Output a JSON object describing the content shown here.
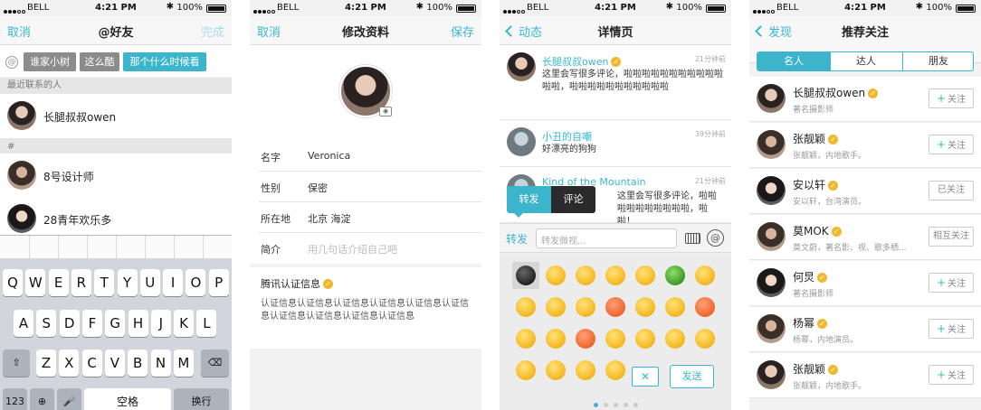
{
  "status": {
    "carrier": "BELL",
    "time": "4:21 PM",
    "battery": "100%"
  },
  "screen1": {
    "nav": {
      "left": "取消",
      "title": "@好友",
      "right": "完成"
    },
    "tags": [
      "谁家小树",
      "这么酷",
      "那个什么时候看"
    ],
    "recent_header": "最近联系的人",
    "recent": [
      {
        "name": "长腿叔叔owen"
      }
    ],
    "hash_header": "#",
    "contacts": [
      {
        "name": "8号设计师"
      },
      {
        "name": "28青年欢乐多"
      }
    ],
    "keyboard": {
      "row1": [
        "Q",
        "W",
        "E",
        "R",
        "T",
        "Y",
        "U",
        "I",
        "O",
        "P"
      ],
      "row2": [
        "A",
        "S",
        "D",
        "F",
        "G",
        "H",
        "J",
        "K",
        "L"
      ],
      "row3": [
        "Z",
        "X",
        "C",
        "V",
        "B",
        "N",
        "M"
      ],
      "num": "123",
      "space": "空格",
      "return": "换行"
    }
  },
  "screen2": {
    "nav": {
      "left": "取消",
      "title": "修改资料",
      "right": "保存"
    },
    "fields": [
      {
        "label": "名字",
        "value": "Veronica"
      },
      {
        "label": "性别",
        "value": "保密"
      },
      {
        "label": "所在地",
        "value": "北京   海淀"
      },
      {
        "label": "简介",
        "value": "用几句话介绍自己吧"
      }
    ],
    "cert_title": "腾讯认证信息",
    "cert_text": "认证信息认证信息认证信息认证信息认证信息认证信息认证信息认证信息认证信息认证信息"
  },
  "screen3": {
    "nav": {
      "left": "动态",
      "title": "详情页"
    },
    "posts": [
      {
        "name": "长腿叔叔owen",
        "time": "21分钟前",
        "body": "这里会写很多评论，啦啦啦啦啦啦啦啦啦啦啦啦啦，啦啦啦啦啦啦啦啦啦啦啦"
      },
      {
        "name": "小丑的自嘲",
        "time": "39分钟前",
        "body": "好漂亮的狗狗"
      },
      {
        "name": "Kind of the Mountain",
        "time": "21分钟前",
        "body": "这里会写很多评论，啦啦啦啦啦啦啦啦啦啦，啦啦！"
      }
    ],
    "popup": {
      "forward": "转发",
      "comment": "评论"
    },
    "input": {
      "mode": "转发",
      "placeholder": "转发微视..."
    },
    "send": "发送"
  },
  "screen4": {
    "nav": {
      "left": "发现",
      "title": "推荐关注"
    },
    "segments": [
      "名人",
      "达人",
      "朋友"
    ],
    "users": [
      {
        "name": "长腿叔叔owen",
        "desc": "著名摄影师",
        "button": "关注",
        "plus": true
      },
      {
        "name": "张靓颖",
        "desc": "张靓颖，内地歌手。",
        "button": "关注",
        "plus": true
      },
      {
        "name": "安以轩",
        "desc": "安以轩，台湾演员。",
        "button": "已关注",
        "plus": false
      },
      {
        "name": "莫MOK",
        "desc": "莫文蔚，著名影、视、歌多栖...",
        "button": "相互关注",
        "plus": false
      },
      {
        "name": "何炅",
        "desc": "著名摄影师",
        "button": "关注",
        "plus": true
      },
      {
        "name": "杨幂",
        "desc": "杨幂，内地演员。",
        "button": "关注",
        "plus": true
      },
      {
        "name": "张靓颖",
        "desc": "张靓颖，内地歌手。",
        "button": "关注",
        "plus": true
      }
    ]
  },
  "colors": {
    "accent": "#39b7cf",
    "verified": "#f0b82d"
  }
}
